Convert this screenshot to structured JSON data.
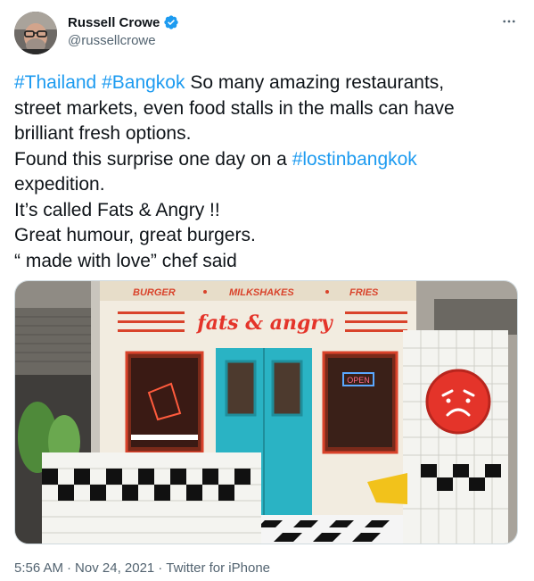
{
  "user": {
    "display_name": "Russell Crowe",
    "handle": "@russellcrowe"
  },
  "tweet": {
    "lines": [
      [
        {
          "t": "#Thailand",
          "tag": true
        },
        {
          "t": " ",
          "tag": false
        },
        {
          "t": "#Bangkok",
          "tag": true
        },
        {
          "t": " So many amazing restaurants,",
          "tag": false
        }
      ],
      [
        {
          "t": "street markets, even food stalls in the malls can have",
          "tag": false
        }
      ],
      [
        {
          "t": "brilliant fresh options.",
          "tag": false
        }
      ],
      [
        {
          "t": "Found this surprise one day on a ",
          "tag": false
        },
        {
          "t": "#lostinbangkok",
          "tag": true
        }
      ],
      [
        {
          "t": "expedition.",
          "tag": false
        }
      ],
      [
        {
          "t": "It’s called Fats & Angry !!",
          "tag": false
        }
      ],
      [
        {
          "t": "Great humour, great burgers.",
          "tag": false
        }
      ],
      [
        {
          "t": "“ made with love” chef said",
          "tag": false
        }
      ]
    ],
    "image_signage": {
      "top_words": [
        "BURGER",
        "MILKSHAKES",
        "FRIES"
      ],
      "neon": "fats & angry",
      "open_sign": "OPEN"
    }
  },
  "meta": {
    "time": "5:56 AM",
    "separator": "·",
    "date": "Nov 24, 2021",
    "source": "Twitter for iPhone"
  },
  "icons": {
    "verified": "verified-badge-icon",
    "more": "more-options-icon"
  },
  "colors": {
    "link": "#1d9bf0",
    "text": "#0f1419",
    "secondary": "#536471"
  }
}
